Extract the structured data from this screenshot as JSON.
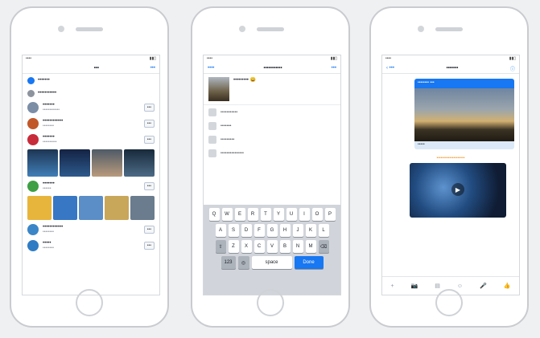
{
  "phone1": {
    "status": {
      "left": "••••",
      "right": "▮▮▯"
    },
    "nav": {
      "title": "•••",
      "right": "•••"
    },
    "menu": [
      {
        "label": "•••••••",
        "color": "#1877f2"
      },
      {
        "label": "•••••••••••",
        "color": "#8d949e"
      }
    ],
    "rows": [
      {
        "title": "•••••••",
        "sub": "••••••••••••",
        "action": "•••",
        "color": "#7b8ea6"
      },
      {
        "title": "••••••••••••",
        "sub": "••••••••",
        "action": "•••",
        "color": "#c1582a"
      },
      {
        "title": "•••••••",
        "sub": "••••••••••",
        "action": "•••",
        "color": "#c82b3a"
      }
    ],
    "rows2": [
      {
        "title": "•••••••",
        "sub": "••••••",
        "action": "•••",
        "color": "#3e9f45"
      }
    ],
    "rows3": [
      {
        "title": "••••••••••••",
        "sub": "••••••••",
        "action": "•••",
        "color": "#3a86c6"
      },
      {
        "title": "•••••",
        "sub": "••••••••",
        "action": "•••",
        "color": "#2f7cc4"
      }
    ]
  },
  "phone2": {
    "status": {
      "left": "••••",
      "right": "▮▮▯"
    },
    "nav": {
      "left": "••••",
      "title": "•••••••••••",
      "right": "•••"
    },
    "compose_text": "••••••••• 😀",
    "options": [
      "•••••••••••",
      "•••••••",
      "•••••••••",
      "•••••••••••••••"
    ],
    "keyboard": {
      "row1": [
        "Q",
        "W",
        "E",
        "R",
        "T",
        "Y",
        "U",
        "I",
        "O",
        "P"
      ],
      "row2": [
        "A",
        "S",
        "D",
        "F",
        "G",
        "H",
        "J",
        "K",
        "L"
      ],
      "row3": [
        "⇧",
        "Z",
        "X",
        "C",
        "V",
        "B",
        "N",
        "M",
        "⌫"
      ],
      "space": "space",
      "go": "Done"
    }
  },
  "phone3": {
    "status": {
      "left": "••••",
      "right": "▮▮▯"
    },
    "nav": {
      "left": "‹ •••",
      "title": "•••••••",
      "right": "ⓘ"
    },
    "card_head": "•••••••• •••",
    "card_foot": "•••••",
    "note": "••••••••••••••••••••",
    "play": "▶",
    "composer": [
      "+",
      "📷",
      "▤",
      "☺",
      "🎤",
      "👍"
    ]
  }
}
